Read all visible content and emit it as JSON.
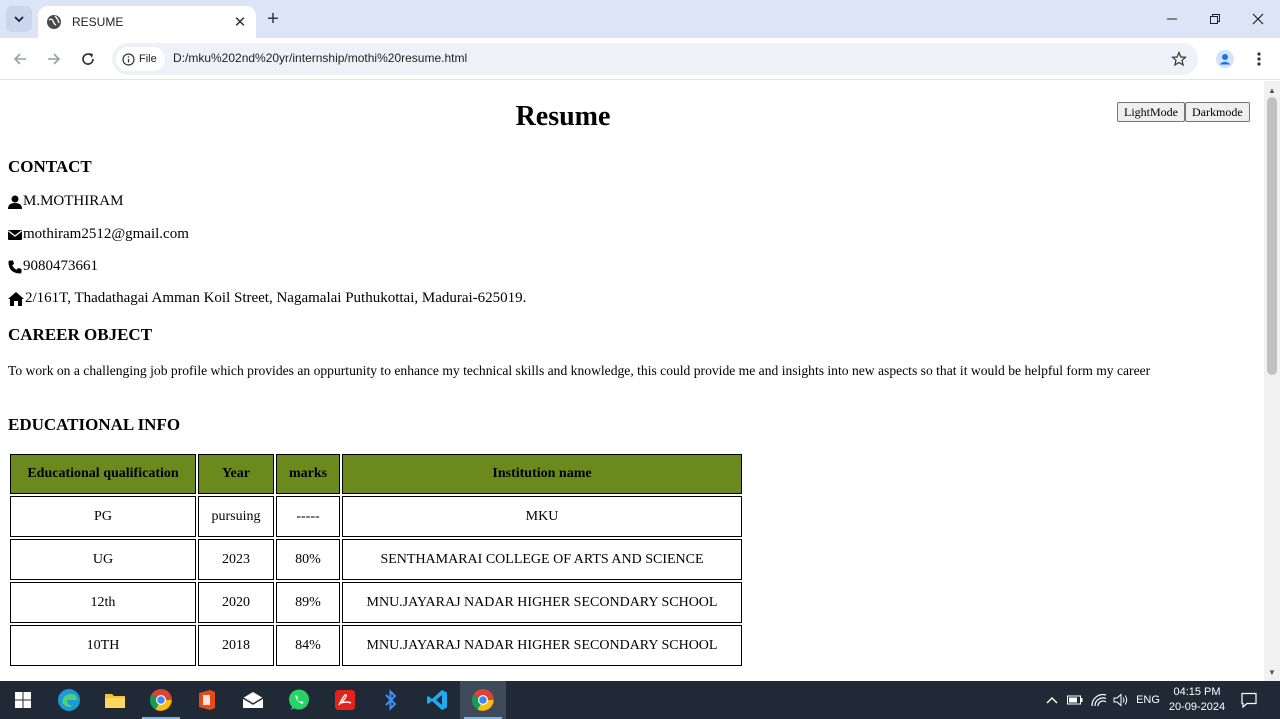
{
  "browser": {
    "tab_title": "RESUME",
    "new_tab_label": "+",
    "url_chip": "File",
    "url": "D:/mku%202nd%20yr/internship/mothi%20resume.html"
  },
  "page": {
    "title": "Resume",
    "mode_buttons": {
      "light": "LightMode",
      "dark": "Darkmode"
    },
    "contact": {
      "heading": "CONTACT",
      "name": "M.MOTHIRAM",
      "email": "mothiram2512@gmail.com",
      "phone": "9080473661",
      "address": "2/161T, Thadathagai Amman Koil Street, Nagamalai Puthukottai, Madurai-625019."
    },
    "career": {
      "heading": "CAREER OBJECT",
      "text": "To work on a challenging job profile which provides an oppurtunity to enhance my technical skills and knowledge, this could provide me and insights into new aspects so that it would be helpful form my career"
    },
    "education": {
      "heading": "EDUCATIONAL INFO",
      "columns": [
        "Educational qualification",
        "Year",
        "marks",
        "Institution name"
      ],
      "header_color": "#6b8a1e",
      "rows": [
        [
          "PG",
          "pursuing",
          "-----",
          "MKU"
        ],
        [
          "UG",
          "2023",
          "80%",
          "SENTHAMARAI COLLEGE OF ARTS AND SCIENCE"
        ],
        [
          "12th",
          "2020",
          "89%",
          "MNU.JAYARAJ NADAR HIGHER SECONDARY SCHOOL"
        ],
        [
          "10TH",
          "2018",
          "84%",
          "MNU.JAYARAJ NADAR HIGHER SECONDARY SCHOOL"
        ]
      ]
    }
  },
  "taskbar": {
    "apps": [
      "windows-start",
      "edge",
      "file-explorer",
      "chrome",
      "office",
      "mail",
      "whatsapp",
      "acrobat",
      "bluetooth",
      "vscode",
      "chrome-active"
    ],
    "language": "ENG",
    "time": "04:15 PM",
    "date": "20-09-2024"
  }
}
